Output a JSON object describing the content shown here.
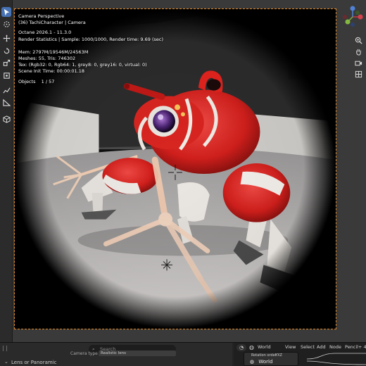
{
  "viewport": {
    "camera_title": "Camera Perspective",
    "object_line": "(36) TachiCharacter | Camera",
    "octane_version": "Octane 2026.1 - 11.3.0",
    "render_stats": "Render Statistics | Sample: 1000/1000, Render time: 9.69 (sec)",
    "mem": "Mem: 2797M/19546M/24563M",
    "meshes": "Meshes: 55, Tris: 746302",
    "tex": "Tex: (Rgb32: 0, Rgb64: 1, grey8: 0, grey16: 0, virtual: 0)",
    "scene_init": "Scene Init Time: 00:00:01.18",
    "objects_label": "Objects",
    "objects_count": "1 / 57"
  },
  "toolbar": {
    "icons": [
      "select-cursor-icon",
      "cursor-icon",
      "move-icon",
      "rotate-icon",
      "scale-icon",
      "transform-icon",
      "annotate-icon",
      "measure-icon",
      "add-cube-icon"
    ]
  },
  "navigation": {
    "gizmo_axes": [
      "X",
      "Y",
      "Z"
    ],
    "buttons": [
      "zoom-icon",
      "hand-pan-icon",
      "camera-view-icon",
      "grid-ortho-icon"
    ]
  },
  "properties": {
    "search_placeholder": "Search",
    "camera_type_label": "Camera type",
    "camera_type_value": "Realistic lens",
    "section_lens": "Lens or Panoramic"
  },
  "node_editor": {
    "world_selector": "World",
    "menu": [
      "View",
      "Select",
      "Add",
      "Node"
    ],
    "workspace": "Pencil+ 4",
    "node_rotation_label": "Rotation order",
    "node_rotation_value": "YXZ",
    "node_world_label": "World"
  },
  "colors": {
    "accent": "#4772b3",
    "frame_border": "#e08a2a",
    "robot_red": "#d9221f"
  }
}
